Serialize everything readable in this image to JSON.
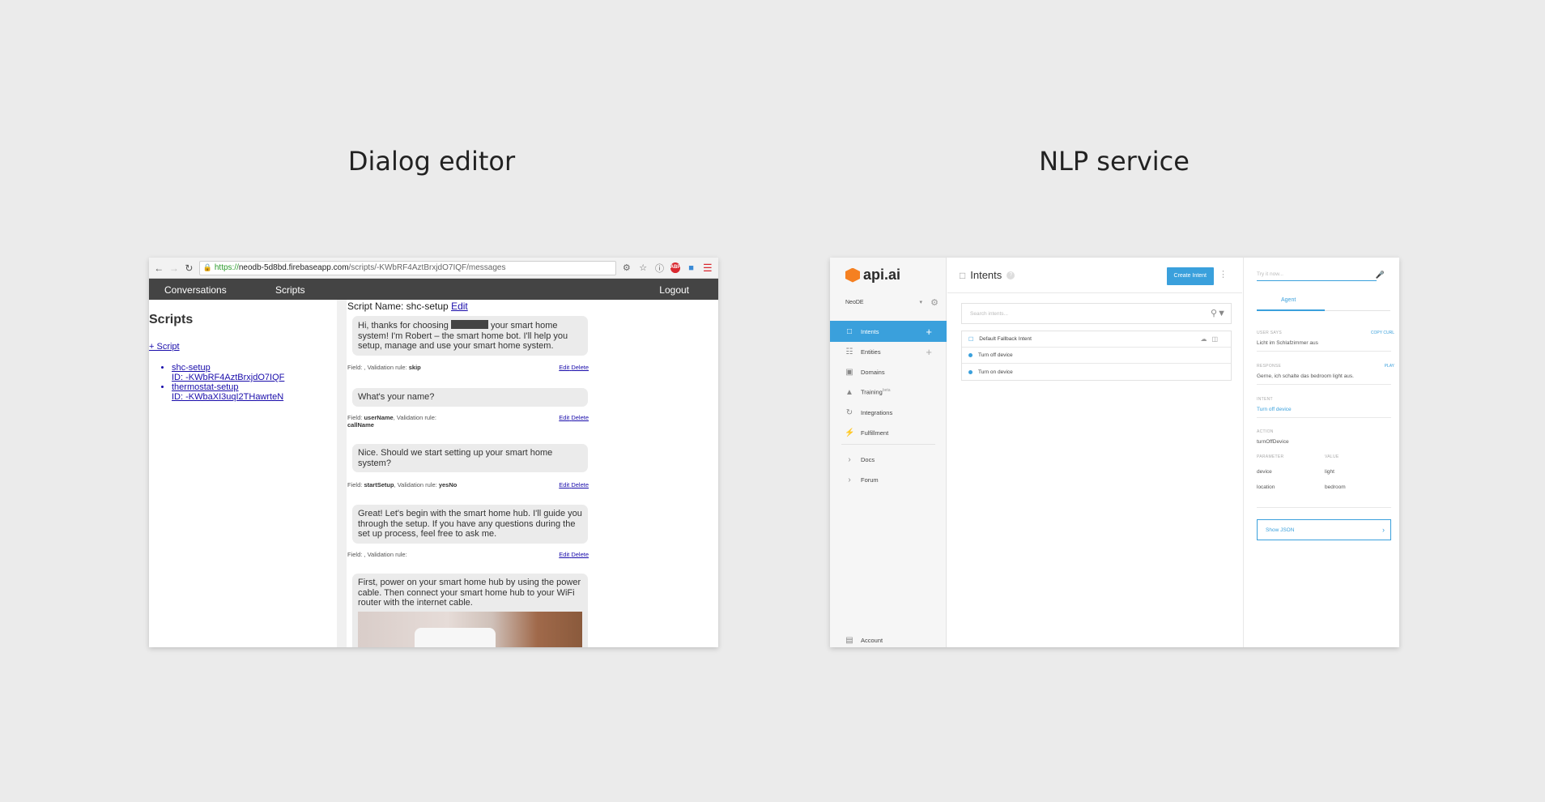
{
  "headings": {
    "left": "Dialog editor",
    "right": "NLP service"
  },
  "dialog_editor": {
    "browser": {
      "url_proto": "https://",
      "url_host": "neodb-5d8bd.firebaseapp.com",
      "url_path": "/scripts/-KWbRF4AztBrxjdO7IQF/messages"
    },
    "nav": {
      "conversations": "Conversations",
      "scripts": "Scripts",
      "logout": "Logout"
    },
    "sidebar": {
      "title": "Scripts",
      "add_script": "+ Script",
      "scripts": [
        {
          "name": "shc-setup",
          "id": "ID: -KWbRF4AztBrxjdO7IQF"
        },
        {
          "name": "thermostat-setup",
          "id": "ID: -KWbaXI3uqI2THawrteN"
        }
      ]
    },
    "script_name_label": "Script Name: shc-setup",
    "script_edit": "Edit",
    "messages": [
      {
        "text_before": "Hi, thanks for choosing",
        "text_after": "your smart home system! I'm Robert – the smart home bot. I'll help you setup, manage and use your smart home system.",
        "field": "",
        "rule": "skip"
      },
      {
        "text": "What's your name?",
        "field": "userName",
        "rule": "callName"
      },
      {
        "text": "Nice. Should we start setting up your smart home system?",
        "field": "startSetup",
        "rule": "yesNo"
      },
      {
        "text": "Great! Let's begin with the smart home hub. I'll guide you through the setup. If you have any questions during the set up process, feel free to ask me.",
        "field": "",
        "rule": ""
      },
      {
        "text": "First, power on your smart home hub by using the power cable. Then connect your smart home hub to your WiFi router with the internet cable."
      }
    ],
    "labels": {
      "field": "Field: ",
      "rule_sep": ", Validation rule: ",
      "edit": "Edit",
      "delete": "Delete"
    }
  },
  "nlp": {
    "logo": "api.ai",
    "agent": "NeoDE",
    "sidebar": [
      {
        "label": "Intents",
        "icon": "chat-icon",
        "active": true,
        "plus": true
      },
      {
        "label": "Entities",
        "icon": "entities-icon",
        "plus": true
      },
      {
        "label": "Domains",
        "icon": "domains-icon"
      },
      {
        "label": "Training",
        "icon": "training-icon",
        "sup": "beta"
      },
      {
        "label": "Integrations",
        "icon": "integrations-icon"
      },
      {
        "label": "Fulfillment",
        "icon": "bolt-icon"
      },
      {
        "label": "Docs",
        "icon": "chevron-right-icon"
      },
      {
        "label": "Forum",
        "icon": "chevron-right-icon"
      }
    ],
    "account": "Account",
    "center": {
      "title": "Intents",
      "create_button": "Create Intent",
      "search_placeholder": "Search intents...",
      "intents": [
        "Default Fallback Intent",
        "Turn off device",
        "Turn on device"
      ]
    },
    "right": {
      "try_placeholder": "Try it now...",
      "tab": "Agent",
      "user_says_label": "USER SAYS",
      "copy_curl": "COPY CURL",
      "user_says": "Licht im Schlafzimmer aus",
      "response_label": "RESPONSE",
      "play": "PLAY",
      "response": "Gerne, ich schalte das bedroom light aus.",
      "intent_label": "INTENT",
      "intent": "Turn off device",
      "action_label": "ACTION",
      "action": "turnOffDevice",
      "parameter_label": "PARAMETER",
      "value_label": "VALUE",
      "params": [
        {
          "name": "device",
          "value": "light"
        },
        {
          "name": "location",
          "value": "bedroom"
        }
      ],
      "show_json": "Show JSON"
    }
  }
}
